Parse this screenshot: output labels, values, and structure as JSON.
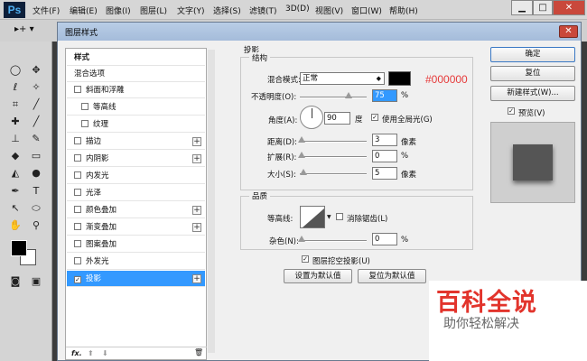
{
  "menubar": {
    "logo": "Ps",
    "items": [
      "文件(F)",
      "编辑(E)",
      "图像(I)",
      "图层(L)",
      "文字(Y)",
      "选择(S)",
      "滤镜(T)",
      "3D(D)",
      "视图(V)",
      "窗口(W)",
      "帮助(H)"
    ],
    "min": "▁",
    "max": "□",
    "close": "✕"
  },
  "options": {
    "tool_glyph": "▸+ ▾"
  },
  "dialog": {
    "title": "图层样式",
    "close": "✕",
    "styles_header": "样式",
    "blend_options": "混合选项",
    "items": [
      {
        "label": "斜面和浮雕",
        "checked": false,
        "plus": false
      },
      {
        "label": "等高线",
        "checked": false,
        "plus": false
      },
      {
        "label": "纹理",
        "checked": false,
        "plus": false
      },
      {
        "label": "描边",
        "checked": false,
        "plus": true
      },
      {
        "label": "内阴影",
        "checked": false,
        "plus": true
      },
      {
        "label": "内发光",
        "checked": false,
        "plus": false
      },
      {
        "label": "光泽",
        "checked": false,
        "plus": false
      },
      {
        "label": "颜色叠加",
        "checked": false,
        "plus": true
      },
      {
        "label": "渐变叠加",
        "checked": false,
        "plus": true
      },
      {
        "label": "图案叠加",
        "checked": false,
        "plus": false
      },
      {
        "label": "外发光",
        "checked": false,
        "plus": false
      },
      {
        "label": "投影",
        "checked": true,
        "plus": true
      }
    ],
    "footer": {
      "fx": "fx.",
      "up": "⬆",
      "down": "⬇",
      "trash": "🗑"
    },
    "section_title": "投影",
    "structure": {
      "title": "结构",
      "blend_mode_label": "混合模式:",
      "blend_mode_value": "正常",
      "color_hex": "#000000",
      "opacity_label": "不透明度(O):",
      "opacity_value": "75",
      "pct": "%",
      "angle_label": "角度(A):",
      "angle_value": "90",
      "deg": "度",
      "use_global_label": "使用全局光(G)",
      "distance_label": "距离(D):",
      "distance_value": "3",
      "spread_label": "扩展(R):",
      "spread_value": "0",
      "size_label": "大小(S):",
      "size_value": "5",
      "px": "像素"
    },
    "quality": {
      "title": "品质",
      "contour_label": "等高线:",
      "antialias_label": "消除锯齿(L)",
      "noise_label": "杂色(N):",
      "noise_value": "0",
      "pct": "%"
    },
    "knockout_label": "图层挖空投影(U)",
    "set_default": "设置为默认值",
    "reset_default": "复位为默认值",
    "ok": "确定",
    "reset": "复位",
    "new_style": "新建样式(W)...",
    "preview_label": "预览(V)"
  },
  "watermark": {
    "title": "百科全说",
    "subtitle": "助你轻松解决"
  }
}
